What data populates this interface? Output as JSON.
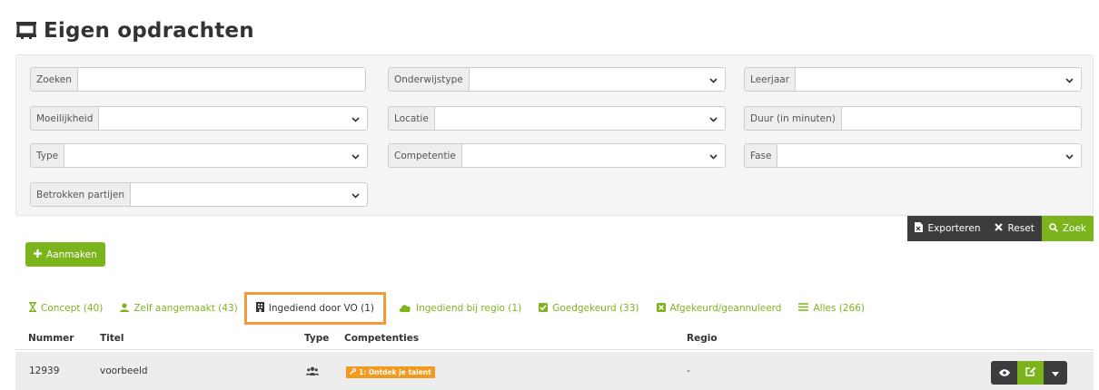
{
  "page": {
    "title": "Eigen opdrachten"
  },
  "filters": {
    "zoeken": "Zoeken",
    "onderwijstype": "Onderwijstype",
    "leerjaar": "Leerjaar",
    "moeilijkheid": "Moeilijkheid",
    "locatie": "Locatie",
    "duur": "Duur (in minuten)",
    "type": "Type",
    "competentie": "Competentie",
    "fase": "Fase",
    "betrokken": "Betrokken partijen"
  },
  "actions": {
    "exporteren": "Exporteren",
    "reset": "Reset",
    "zoek": "Zoek",
    "aanmaken": "Aanmaken"
  },
  "tabs": [
    {
      "label": "Concept (40)",
      "icon": "hourglass-icon"
    },
    {
      "label": "Zelf aangemaakt (43)",
      "icon": "user-icon"
    },
    {
      "label": "Ingediend door VO (1)",
      "icon": "building-icon"
    },
    {
      "label": "Ingediend bij regio (1)",
      "icon": "cloud-icon"
    },
    {
      "label": "Goedgekeurd (33)",
      "icon": "check-square-icon"
    },
    {
      "label": "Afgekeurd/geannuleerd",
      "icon": "x-square-icon"
    },
    {
      "label": "Alles (266)",
      "icon": "list-icon"
    }
  ],
  "table": {
    "headers": [
      "Nummer",
      "Titel",
      "Type",
      "Competenties",
      "Regio"
    ],
    "rows": [
      {
        "nummer": "12939",
        "titel": "voorbeeld",
        "type_icon": "users-icon",
        "competentie": "1: Ontdek je talent",
        "regio": "-"
      }
    ]
  },
  "colors": {
    "accent": "#7cb41d",
    "dark": "#3c3c3c",
    "highlight": "#f39a36",
    "badge": "#f39a1e"
  }
}
